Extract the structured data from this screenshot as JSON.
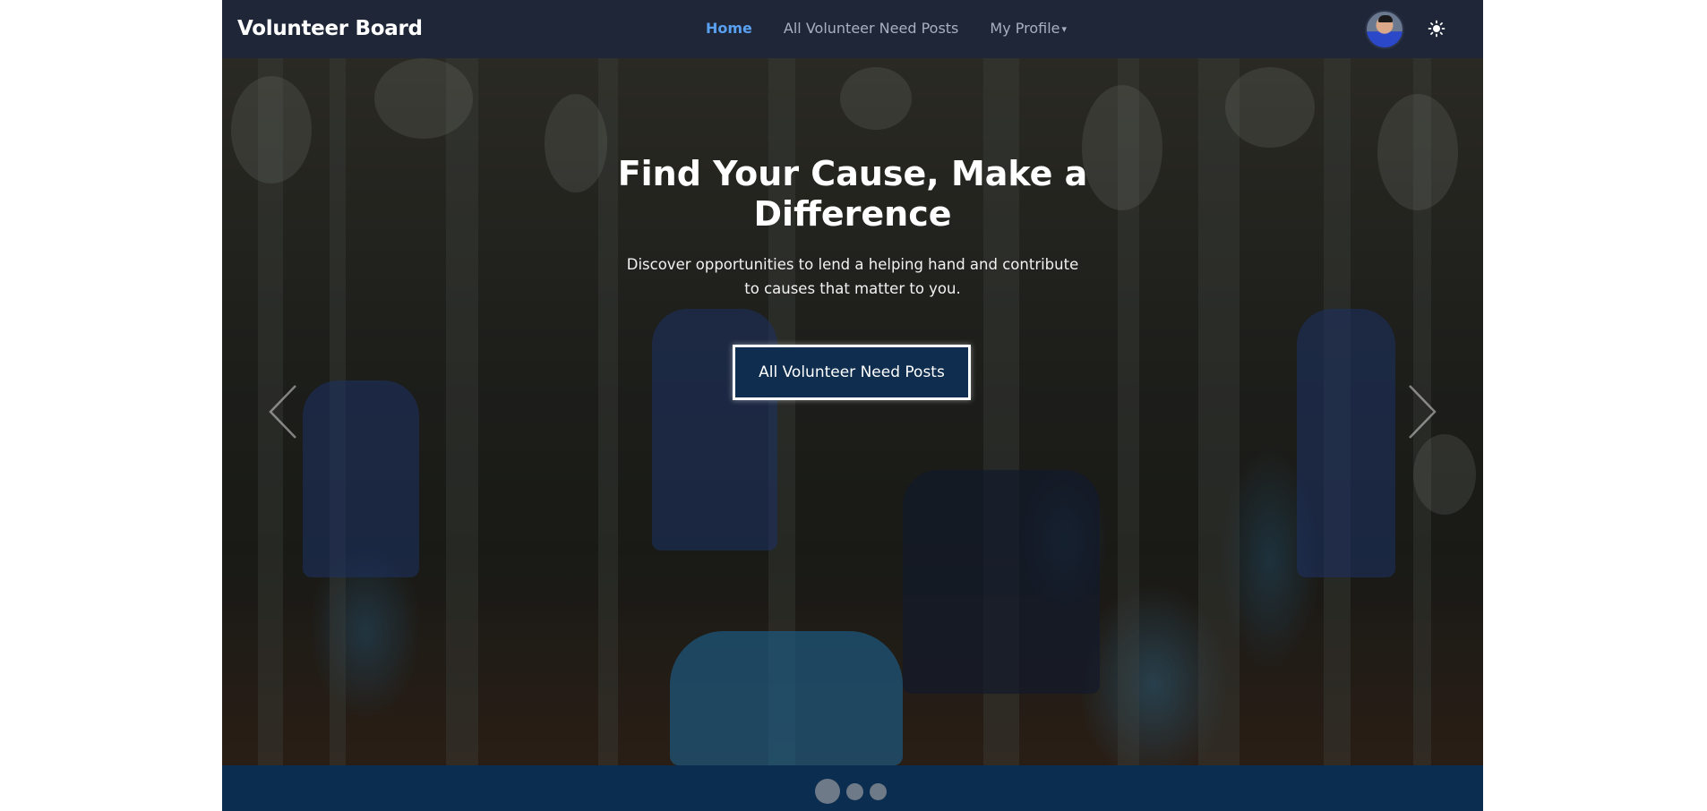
{
  "navbar": {
    "brand": "Volunteer Board",
    "links": [
      {
        "label": "Home",
        "active": true
      },
      {
        "label": "All Volunteer Need Posts",
        "active": false
      },
      {
        "label": "My Profile",
        "active": false
      }
    ],
    "profile_icon": "chevron-down-icon",
    "theme_icon": "sun-icon"
  },
  "hero": {
    "title": "Find Your Cause, Make a Difference",
    "subtitle": "Discover opportunities to lend a helping hand and contribute to causes that matter to you.",
    "button_label": "All Volunteer Need Posts",
    "prev_icon": "chevron-left-icon",
    "next_icon": "chevron-right-icon"
  },
  "carousel": {
    "slide_count": 3,
    "active_index": 0
  },
  "colors": {
    "navbar_bg": "#1e2638",
    "accent": "#5aa0f0",
    "button_bg": "#0e2d4f",
    "footer_bar": "#0b2d4f"
  }
}
